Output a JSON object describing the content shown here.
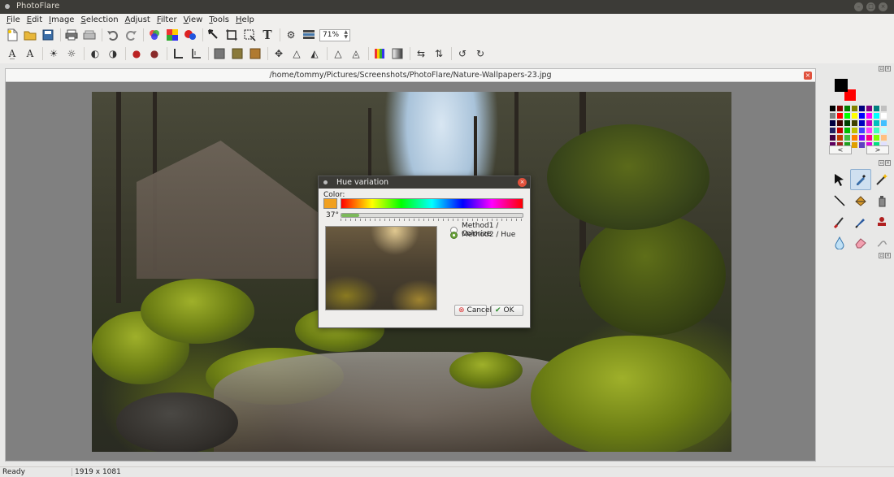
{
  "window": {
    "title": "PhotoFlare"
  },
  "menu": [
    {
      "pre": "",
      "u": "F",
      "post": "ile"
    },
    {
      "pre": "",
      "u": "E",
      "post": "dit"
    },
    {
      "pre": "",
      "u": "I",
      "post": "mage"
    },
    {
      "pre": "",
      "u": "S",
      "post": "election"
    },
    {
      "pre": "",
      "u": "A",
      "post": "djust"
    },
    {
      "pre": "",
      "u": "F",
      "post": "ilter"
    },
    {
      "pre": "",
      "u": "V",
      "post": "iew"
    },
    {
      "pre": "",
      "u": "T",
      "post": "ools"
    },
    {
      "pre": "",
      "u": "H",
      "post": "elp"
    }
  ],
  "toolbar": {
    "zoom_value": "71%"
  },
  "document": {
    "path": "/home/tommy/Pictures/Screenshots/PhotoFlare/Nature-Wallpapers-23.jpg"
  },
  "dialog": {
    "title": "Hue variation",
    "color_label": "Color:",
    "hue_degrees": "37°",
    "slider_fraction": 0.1,
    "method1_label": "Method1 / Colorize",
    "method2_label": "Method2 / Hue",
    "selected_method": "method2",
    "cancel_label": "Cancel",
    "ok_label": "OK",
    "selected_color": "#f0a020"
  },
  "palette": {
    "foreground": "#000000",
    "background": "#ff0000",
    "prev_label": "<",
    "next_label": ">",
    "swatches": [
      "#000000",
      "#800000",
      "#008000",
      "#808000",
      "#000080",
      "#800080",
      "#008080",
      "#c0c0c0",
      "#808080",
      "#ff0000",
      "#00ff00",
      "#ffff00",
      "#0000ff",
      "#ff00ff",
      "#00ffff",
      "#ffffff",
      "#000040",
      "#400000",
      "#004000",
      "#404000",
      "#0000c0",
      "#c000c0",
      "#00c0c0",
      "#40c0ff",
      "#202060",
      "#c00000",
      "#00c000",
      "#c0c000",
      "#4040ff",
      "#ff40ff",
      "#40ffc0",
      "#c0ffff",
      "#400040",
      "#c04000",
      "#40c040",
      "#ff8000",
      "#8000ff",
      "#ff0080",
      "#80ff00",
      "#ffc080",
      "#600060",
      "#a02020",
      "#20a020",
      "#e0a000",
      "#6040c0",
      "#e000e0",
      "#00e080",
      "#e0e0ff"
    ]
  },
  "status": {
    "text": "Ready",
    "image_size": "1919 x 1081"
  }
}
